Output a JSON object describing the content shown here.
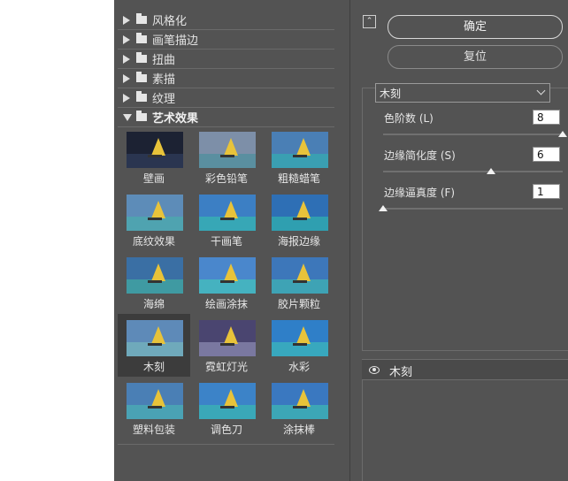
{
  "gallery": {
    "folders": [
      {
        "label": "风格化",
        "expanded": false
      },
      {
        "label": "画笔描边",
        "expanded": false
      },
      {
        "label": "扭曲",
        "expanded": false
      },
      {
        "label": "素描",
        "expanded": false
      },
      {
        "label": "纹理",
        "expanded": false
      },
      {
        "label": "艺术效果",
        "expanded": true
      }
    ],
    "filters": [
      {
        "label": "壁画",
        "sky": "#1c2233",
        "sea": "#2a3550"
      },
      {
        "label": "彩色铅笔",
        "sky": "#7d8fa8",
        "sea": "#5a8fa0"
      },
      {
        "label": "粗糙蜡笔",
        "sky": "#4a7fb5",
        "sea": "#3a9fb2"
      },
      {
        "label": "底纹效果",
        "sky": "#5d8cb8",
        "sea": "#4fa3b0"
      },
      {
        "label": "干画笔",
        "sky": "#3c7fc4",
        "sea": "#37a7b6"
      },
      {
        "label": "海报边缘",
        "sky": "#2e6fb5",
        "sea": "#2f9fb0"
      },
      {
        "label": "海绵",
        "sky": "#3a6fa4",
        "sea": "#3f9aa2"
      },
      {
        "label": "绘画涂抹",
        "sky": "#4a87cc",
        "sea": "#45b2c0"
      },
      {
        "label": "胶片颗粒",
        "sky": "#3d77ba",
        "sea": "#3ea3b5"
      },
      {
        "label": "木刻",
        "sky": "#5e8ab8",
        "sea": "#6fa9bb"
      },
      {
        "label": "霓虹灯光",
        "sky": "#4a4570",
        "sea": "#7a78a0"
      },
      {
        "label": "水彩",
        "sky": "#2f7fc8",
        "sea": "#38a8be"
      },
      {
        "label": "塑料包装",
        "sky": "#4a7fb5",
        "sea": "#4aa2b4"
      },
      {
        "label": "调色刀",
        "sky": "#3c83c8",
        "sea": "#3aa8b8"
      },
      {
        "label": "涂抹棒",
        "sky": "#3a78c0",
        "sea": "#3ca6b6"
      }
    ],
    "selected_filter": "木刻"
  },
  "buttons": {
    "ok_label": "确定",
    "reset_label": "复位"
  },
  "collapse_icon": "collapse-up-icon",
  "filter_select": {
    "value": "木刻"
  },
  "params": [
    {
      "label": "色阶数 (L)",
      "value": "8",
      "level": 1.0
    },
    {
      "label": "边缘简化度 (S)",
      "value": "6",
      "level": 0.6
    },
    {
      "label": "边缘逼真度 (F)",
      "value": "1",
      "level": 0.0
    }
  ],
  "layer": {
    "name": "木刻",
    "visible": true
  }
}
